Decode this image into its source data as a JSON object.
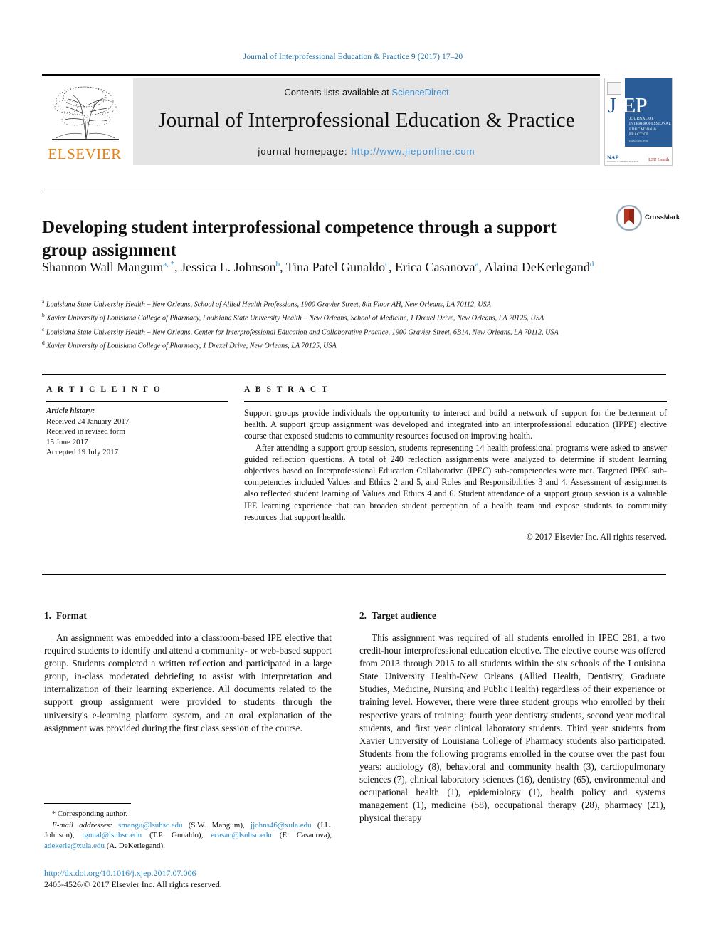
{
  "running_head": "Journal of Interprofessional Education & Practice 9 (2017) 17–20",
  "masthead": {
    "contents_prefix": "Contents lists available at ",
    "sciencedirect": "ScienceDirect",
    "journal_title": "Journal of Interprofessional Education & Practice",
    "homepage_label": "journal homepage: ",
    "homepage_url": "http://www.jieponline.com",
    "publisher_logo_text": "ELSEVIER",
    "publisher_logo_icon": "elsevier-tree-icon",
    "cover": {
      "acronym_j": "J",
      "acronym_rest": "IEP",
      "subtitle": "JOURNAL OF INTERPROFESSIONAL EDUCATION & PRACTICE",
      "issn": "ISSN 2405-4526",
      "nap_label": "NAP",
      "nap_sub": "NATIONAL ACADEMY OF PRACTICE",
      "lsu_label": "LSU Health"
    }
  },
  "article": {
    "title": "Developing student interprofessional competence through a support group assignment",
    "crossmark_label": "CrossMark",
    "authors_line1": "Shannon Wall Mangum",
    "authors": [
      {
        "name": "Shannon Wall Mangum",
        "marks": "a, *"
      },
      {
        "name": "Jessica L. Johnson",
        "marks": "b"
      },
      {
        "name": "Tina Patel Gunaldo",
        "marks": "c"
      },
      {
        "name": "Erica Casanova",
        "marks": "a"
      },
      {
        "name": "Alaina DeKerlegand",
        "marks": "d"
      }
    ],
    "affiliations": [
      {
        "mark": "a",
        "text": "Louisiana State University Health – New Orleans, School of Allied Health Professions, 1900 Gravier Street, 8th Floor AH, New Orleans, LA 70112, USA"
      },
      {
        "mark": "b",
        "text": "Xavier University of Louisiana College of Pharmacy, Louisiana State University Health – New Orleans, School of Medicine, 1 Drexel Drive, New Orleans, LA 70125, USA"
      },
      {
        "mark": "c",
        "text": "Louisiana State University Health – New Orleans, Center for Interprofessional Education and Collaborative Practice, 1900 Gravier Street, 6B14, New Orleans, LA 70112, USA"
      },
      {
        "mark": "d",
        "text": "Xavier University of Louisiana College of Pharmacy, 1 Drexel Drive, New Orleans, LA 70125, USA"
      }
    ]
  },
  "article_info": {
    "heading": "A R T I C L E  I N F O",
    "history_label": "Article history:",
    "history_lines": [
      "Received 24 January 2017",
      "Received in revised form",
      "15 June 2017",
      "Accepted 19 July 2017"
    ]
  },
  "abstract": {
    "heading": "A B S T R A C T",
    "paragraphs": [
      "Support groups provide individuals the opportunity to interact and build a network of support for the betterment of health. A support group assignment was developed and integrated into an interprofessional education (IPPE) elective course that exposed students to community resources focused on improving health.",
      "After attending a support group session, students representing 14 health professional programs were asked to answer guided reflection questions. A total of 240 reflection assignments were analyzed to determine if student learning objectives based on Interprofessional Education Collaborative (IPEC) sub-competencies were met. Targeted IPEC sub-competencies included Values and Ethics 2 and 5, and Roles and Responsibilities 3 and 4. Assessment of assignments also reflected student learning of Values and Ethics 4 and 6. Student attendance of a support group session is a valuable IPE learning experience that can broaden student perception of a health team and expose students to community resources that support health."
    ],
    "copyright": "© 2017 Elsevier Inc. All rights reserved."
  },
  "sections": [
    {
      "number": "1.",
      "title": "Format",
      "text": "An assignment was embedded into a classroom-based IPE elective that required students to identify and attend a community- or web-based support group. Students completed a written reflection and participated in a large group, in-class moderated debriefing to assist with interpretation and internalization of their learning experience. All documents related to the support group assignment were provided to students through the university's e-learning platform system, and an oral explanation of the assignment was provided during the first class session of the course."
    },
    {
      "number": "2.",
      "title": "Target audience",
      "text": "This assignment was required of all students enrolled in IPEC 281, a two credit-hour interprofessional education elective. The elective course was offered from 2013 through 2015 to all students within the six schools of the Louisiana State University Health-New Orleans (Allied Health, Dentistry, Graduate Studies, Medicine, Nursing and Public Health) regardless of their experience or training level. However, there were three student groups who enrolled by their respective years of training: fourth year dentistry students, second year medical students, and first year clinical laboratory students. Third year students from Xavier University of Louisiana College of Pharmacy students also participated. Students from the following programs enrolled in the course over the past four years: audiology (8), behavioral and community health (3), cardiopulmonary sciences (7), clinical laboratory sciences (16), dentistry (65), environmental and occupational health (1), epidemiology (1), health policy and systems management (1), medicine (58), occupational therapy (28), pharmacy (21), physical therapy"
    }
  ],
  "footnotes": {
    "corresponding": "Corresponding author.",
    "email_label": "E-mail addresses:",
    "emails": [
      {
        "address": "smangu@lsuhsc.edu",
        "owner": "(S.W. Mangum)"
      },
      {
        "address": "jjohns46@xula.edu",
        "owner": "(J.L. Johnson)"
      },
      {
        "address": "tgunal@lsuhsc.edu",
        "owner": "(T.P. Gunaldo)"
      },
      {
        "address": "ecasan@lsuhsc.edu",
        "owner": "(E. Casanova)"
      },
      {
        "address": "adekerle@xula.edu",
        "owner": "(A. DeKerlegand)"
      }
    ]
  },
  "doi": {
    "url": "http://dx.doi.org/10.1016/j.xjep.2017.07.006",
    "issn_line": "2405-4526/© 2017 Elsevier Inc. All rights reserved."
  },
  "colors": {
    "link_blue": "#2787c8",
    "sciencedirect_blue": "#3a8fd4",
    "elsevier_orange": "#E8820C",
    "cover_blue": "#2a5d97"
  }
}
